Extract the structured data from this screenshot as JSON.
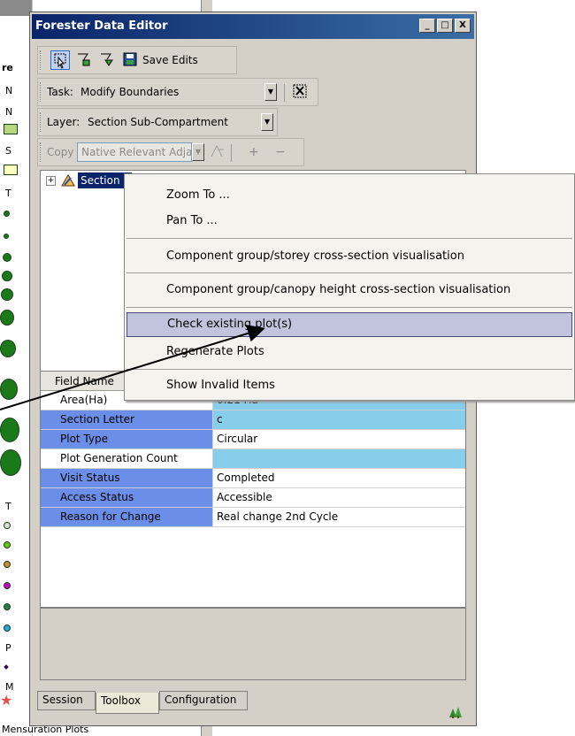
{
  "window": {
    "title": "Forester Data Editor",
    "min_label": "_",
    "max_label": "□",
    "close_label": "X"
  },
  "toolbar": {
    "save_edits_label": "Save Edits"
  },
  "task": {
    "label": "Task:",
    "value": "Modify Boundaries"
  },
  "layer": {
    "label": "Layer:",
    "value": "Section Sub-Compartment"
  },
  "copy": {
    "label": "Copy",
    "value": "Native Relevant Adja",
    "plus": "+",
    "minus": "−"
  },
  "tree": {
    "expander": "+",
    "node_label": "Section c"
  },
  "grid": {
    "header": "Field Name",
    "rows": [
      {
        "field": "Area(Ha)",
        "value": "0.21 Ha"
      },
      {
        "field": "Section Letter",
        "value": "c"
      },
      {
        "field": "Plot Type",
        "value": "Circular"
      },
      {
        "field": "Plot Generation Count",
        "value": ""
      },
      {
        "field": "Visit Status",
        "value": "Completed"
      },
      {
        "field": "Access Status",
        "value": "Accessible"
      },
      {
        "field": "Reason for Change",
        "value": "Real change 2nd Cycle"
      }
    ]
  },
  "tabs": [
    {
      "label": "Session"
    },
    {
      "label": "Toolbox"
    },
    {
      "label": "Configuration"
    }
  ],
  "context_menu": {
    "items": [
      "Zoom To ...",
      "Pan To ...",
      "Component group/storey cross-section visualisation",
      "Component group/canopy height cross-section visualisation",
      "Check existing plot(s)",
      "Regenerate Plots",
      "Show Invalid Items"
    ],
    "highlighted_index": 4
  },
  "background_toc": {
    "letters": [
      "re",
      "N",
      "N",
      "S",
      "T",
      "T",
      "P",
      "M"
    ],
    "bottom_label": "Mensuration Plots"
  },
  "colors": {
    "title_start": "#0a246a",
    "title_end": "#3a6ea5",
    "field_highlight": "#6b8ee8",
    "value_highlight": "#87ceeb",
    "menu_highlight": "#c1c4dc",
    "symbol_green": "#1a7a1a"
  }
}
